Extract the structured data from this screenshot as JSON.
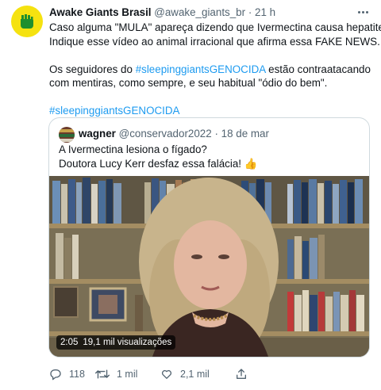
{
  "tweet": {
    "author_name": "Awake Giants Brasil",
    "author_handle": "@awake_giants_br",
    "separator": "·",
    "time": "21 h",
    "lines": [
      "Caso alguma \"MULA\" apareça dizendo que Ivermectina causa hepatite.",
      "Indique esse vídeo ao animal irracional que afirma essa FAKE NEWS."
    ],
    "para2_prefix": "Os seguidores do ",
    "para2_hashtag": "#sleepinggiantsGENOCIDA",
    "para2_suffix": " estão contraatacando",
    "para2_line2": "com mentiras, como sempre, e seu habitual \"ódio do bem\".",
    "hashtag_line": "#sleepinggiantsGENOCIDA"
  },
  "quoted": {
    "author_name": "wagner",
    "author_handle": "@conservador2022",
    "separator": "·",
    "date": "18 de mar",
    "line1": "A Ivermectina lesiona o fígado?",
    "line2": "Doutora Lucy Kerr desfaz essa falácia!",
    "emoji": "👍",
    "video": {
      "duration": "2:05",
      "views": "19,1 mil visualizações"
    }
  },
  "actions": {
    "replies": "118",
    "retweets": "1 mil",
    "likes": "2,1 mil"
  },
  "colors": {
    "accent": "#1d9bf0",
    "secondary_text": "#536471",
    "border": "#cfd9de",
    "avatar_bg": "#f5e210"
  },
  "icons": [
    "fist-logo-icon",
    "more-icon",
    "reply-icon",
    "retweet-icon",
    "like-icon",
    "share-icon"
  ]
}
